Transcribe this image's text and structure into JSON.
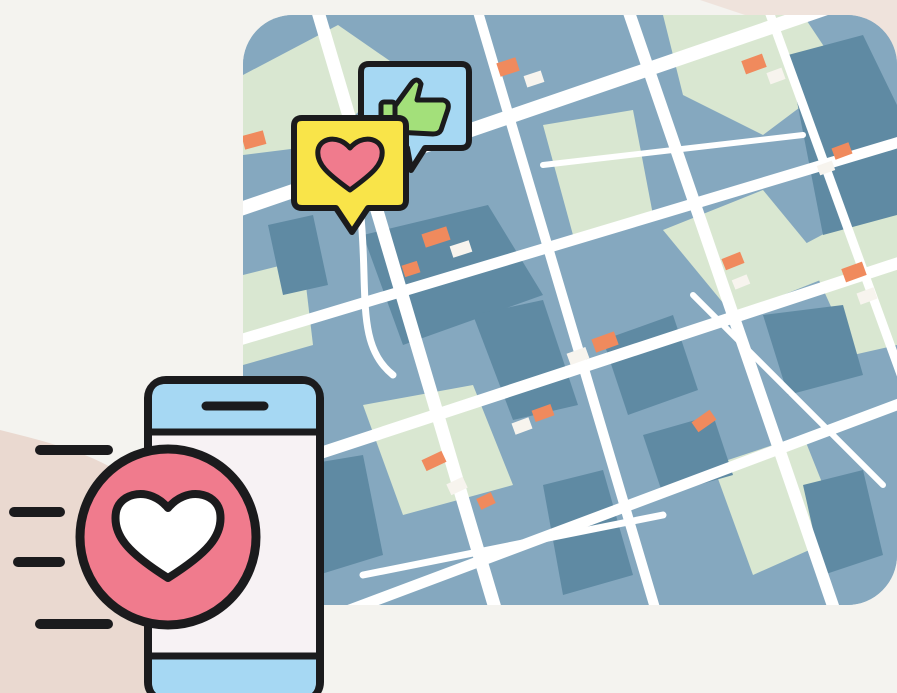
{
  "scene": {
    "colors": {
      "page_background": "#f4f3ef",
      "background_blob": "#eddfd7",
      "map_water_block": "#85a8bf",
      "map_dark_block": "#5f8aa3",
      "map_park": "#d9e7d1",
      "map_road": "#ffffff",
      "map_building_orange": "#f08a5d",
      "map_building_light": "#f7f4ee",
      "bubble_yellow": "#f9e449",
      "bubble_blue": "#a6d8f3",
      "thumb_green": "#a3e07a",
      "heart_pink": "#f07b8d",
      "phone_screen": "#f7f2f4",
      "phone_top_bar": "#a6d8f3",
      "outline": "#1b1b1d"
    },
    "icons": {
      "map": "city-map-icon",
      "heart_bubble": "heart-chat-bubble-icon",
      "like_bubble": "thumbs-up-chat-bubble-icon",
      "phone": "smartphone-icon",
      "heart_badge": "heart-icon",
      "motion_lines": "speed-lines-icon"
    }
  }
}
